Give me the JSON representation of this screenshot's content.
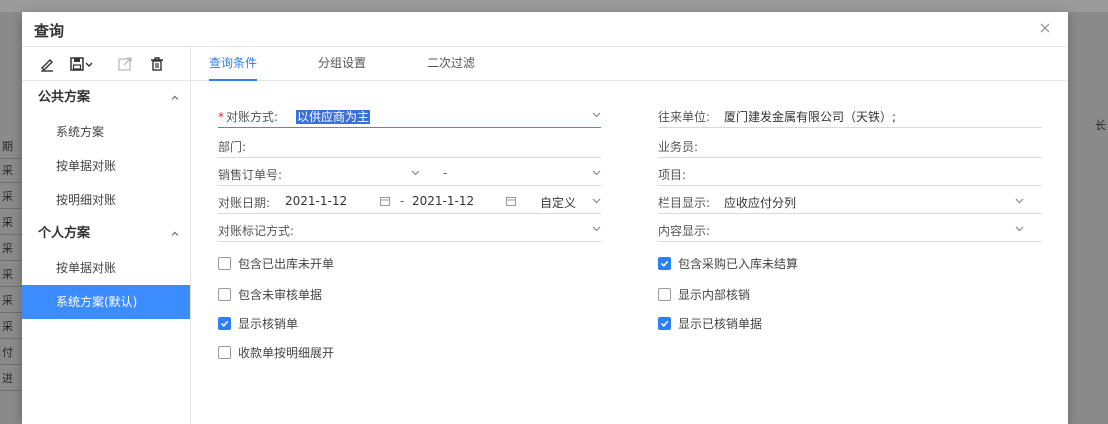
{
  "background": {
    "left_column_snippets": [
      "期",
      "采",
      "采",
      "采",
      "采",
      "采",
      "采",
      "采",
      "付",
      "进"
    ],
    "right_header_snippet": "长"
  },
  "dialog": {
    "title": "查询",
    "close_icon": "close-icon"
  },
  "left_panel": {
    "toolbar_icons": [
      "edit-icon",
      "save-icon",
      "chevron-down-icon",
      "export-icon",
      "delete-icon"
    ],
    "groups": [
      {
        "title": "公共方案",
        "items": [
          "系统方案",
          "按单据对账",
          "按明细对账"
        ]
      },
      {
        "title": "个人方案",
        "items": [
          "按单据对账",
          "系统方案(默认)"
        ]
      }
    ]
  },
  "tabs": [
    "查询条件",
    "分组设置",
    "二次过滤"
  ],
  "form": {
    "reconcile_method_label": "对账方式:",
    "reconcile_method_value": "以供应商为主",
    "dept_label": "部门:",
    "sales_order_label": "销售订单号:",
    "sales_order_sep": "-",
    "date_label": "对账日期:",
    "date_from": "2021-1-12",
    "date_sep": "-",
    "date_to": "2021-1-12",
    "date_mode": "自定义",
    "mark_method_label": "对账标记方式:",
    "partner_label": "往来单位:",
    "partner_value": "厦门建发金属有限公司（天铁）;",
    "salesman_label": "业务员:",
    "project_label": "项目:",
    "column_display_label": "栏目显示:",
    "column_display_value": "应收应付分列",
    "content_display_label": "内容显示:"
  },
  "checkboxes_left": [
    {
      "label": "包含已出库未开单",
      "checked": false
    },
    {
      "label": "包含未审核单据",
      "checked": false
    },
    {
      "label": "显示核销单",
      "checked": true
    },
    {
      "label": "收款单按明细展开",
      "checked": false
    }
  ],
  "checkboxes_right": [
    {
      "label": "包含采购已入库未结算",
      "checked": true
    },
    {
      "label": "显示内部核销",
      "checked": false
    },
    {
      "label": "显示已核销单据",
      "checked": true
    }
  ],
  "colors": {
    "accent": "#2f7ef6",
    "active_item_bg": "#3b8cff",
    "required_star": "#f5222d"
  }
}
